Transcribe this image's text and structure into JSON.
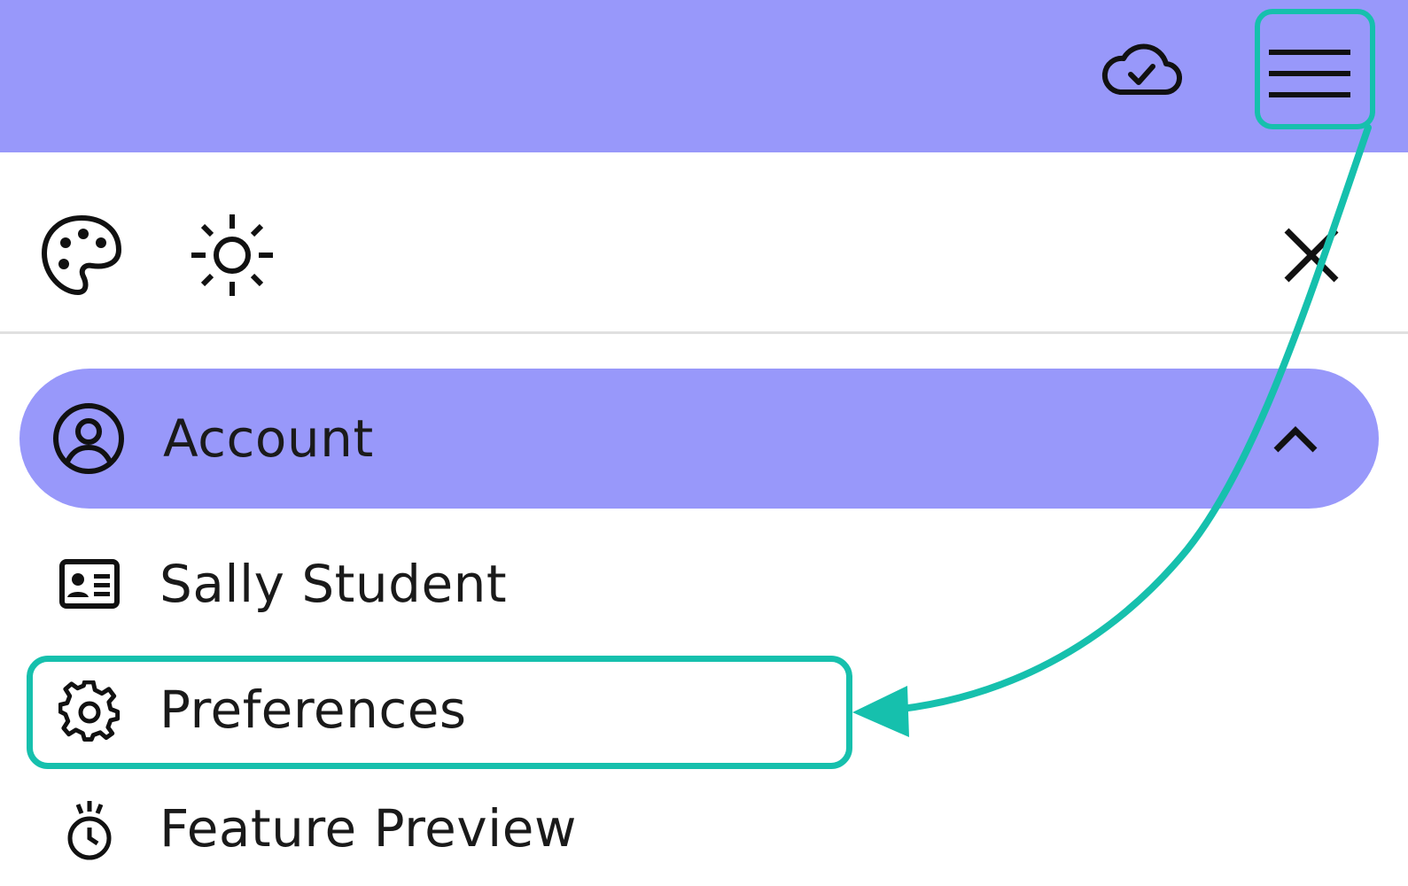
{
  "colors": {
    "accent": "#9898fa",
    "highlight": "#16c0ad",
    "divider": "#e0e0e0",
    "text": "#1a1a1a"
  },
  "topbar": {
    "sync_icon": "cloud-check-icon",
    "menu_icon": "hamburger-menu-icon"
  },
  "toolbar": {
    "theme_icon": "palette-icon",
    "brightness_icon": "sun-icon",
    "close_icon": "close-icon"
  },
  "menu": {
    "section": {
      "label": "Account",
      "icon": "user-circle-icon",
      "toggle_icon": "chevron-up-icon"
    },
    "items": [
      {
        "label": "Sally Student",
        "icon": "id-card-icon"
      },
      {
        "label": "Preferences",
        "icon": "gear-icon"
      },
      {
        "label": "Feature Preview",
        "icon": "alarm-clock-icon"
      }
    ]
  }
}
